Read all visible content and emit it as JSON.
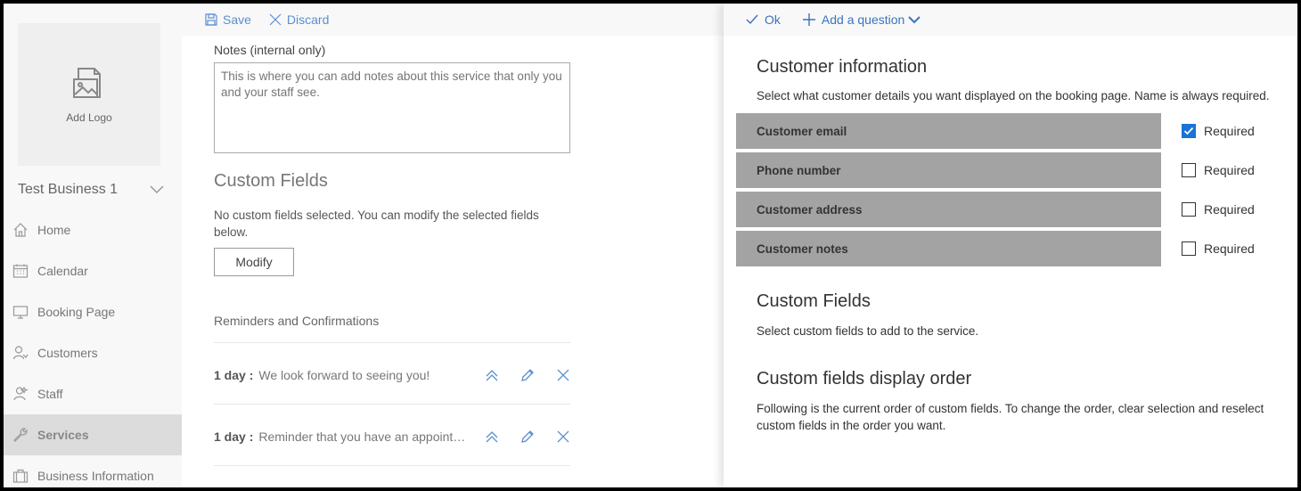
{
  "nav": {
    "logo_label": "Add Logo",
    "business_name": "Test Business 1",
    "items": [
      {
        "label": "Home",
        "icon": "home-icon"
      },
      {
        "label": "Calendar",
        "icon": "calendar-icon"
      },
      {
        "label": "Booking Page",
        "icon": "monitor-icon"
      },
      {
        "label": "Customers",
        "icon": "person-icon"
      },
      {
        "label": "Staff",
        "icon": "staff-icon"
      },
      {
        "label": "Services",
        "icon": "wrench-icon",
        "active": true
      },
      {
        "label": "Business Information",
        "icon": "briefcase-icon"
      }
    ]
  },
  "mid_toolbar": {
    "save_label": "Save",
    "discard_label": "Discard"
  },
  "notes": {
    "label": "Notes (internal only)",
    "placeholder": "This is where you can add notes about this service that only you and your staff see."
  },
  "custom_fields": {
    "title": "Custom Fields",
    "description": "No custom fields selected. You can modify the selected fields below.",
    "modify_label": "Modify"
  },
  "reminders": {
    "title": "Reminders and Confirmations",
    "items": [
      {
        "day": "1 day :",
        "message": "We look forward to seeing you!"
      },
      {
        "day": "1 day :",
        "message": "Reminder that you have an appointment"
      }
    ]
  },
  "right_toolbar": {
    "ok_label": "Ok",
    "add_question_label": "Add a question"
  },
  "customer_info": {
    "title": "Customer information",
    "description": "Select what customer details you want displayed on the booking page. Name is always required.",
    "required_label": "Required",
    "fields": [
      {
        "label": "Customer email",
        "required": true
      },
      {
        "label": "Phone number",
        "required": false
      },
      {
        "label": "Customer address",
        "required": false
      },
      {
        "label": "Customer notes",
        "required": false
      }
    ]
  },
  "custom_fields_panel": {
    "title": "Custom Fields",
    "description": "Select custom fields to add to the service."
  },
  "display_order": {
    "title": "Custom fields display order",
    "description_line1": "Following is the current order of custom fields. To change the order, clear selection and reselect",
    "description_line2": "custom fields in the order you want."
  },
  "colors": {
    "accent": "#1a73d6",
    "link": "#5b8fd0",
    "field_bg": "#a3a3a3"
  }
}
